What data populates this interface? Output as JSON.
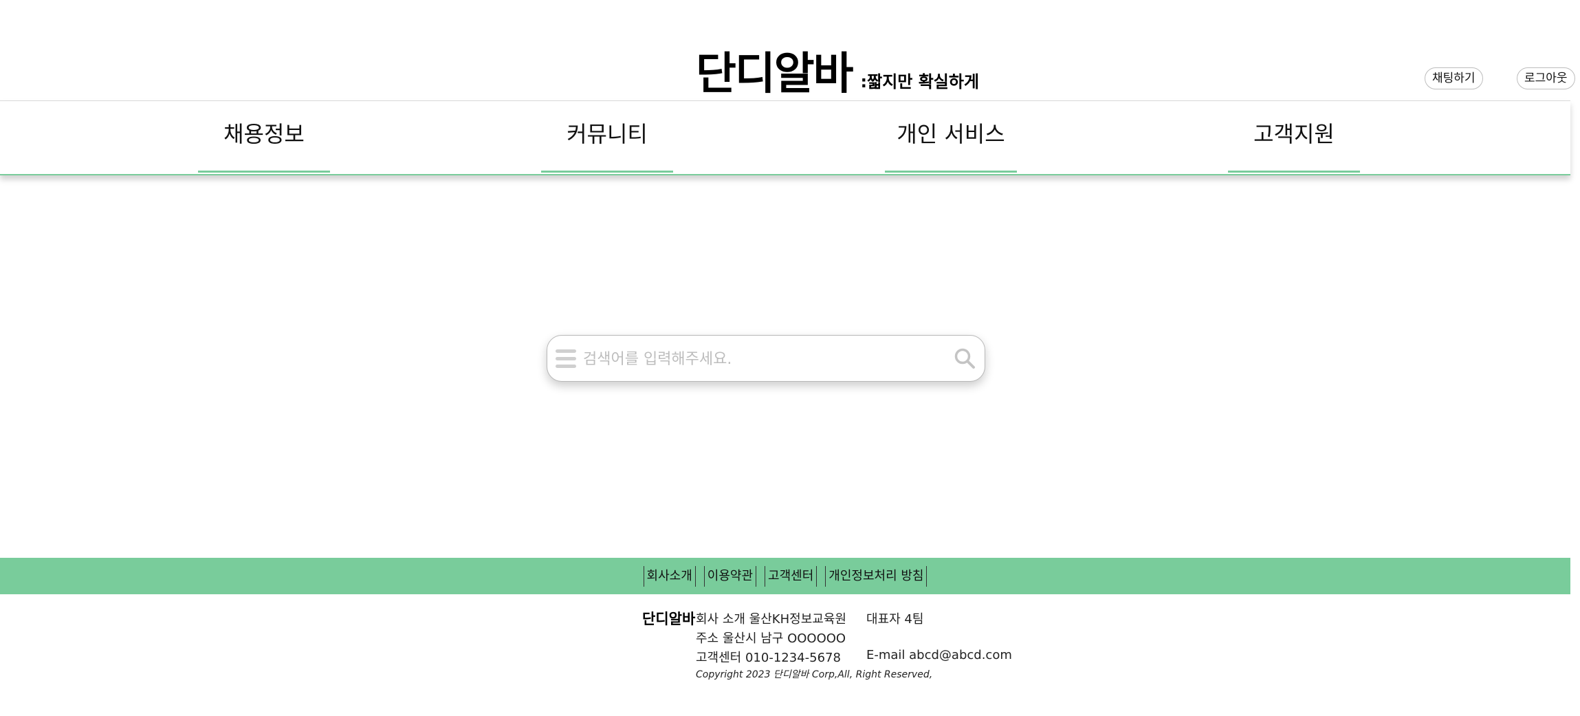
{
  "header": {
    "logo": "단디알바",
    "slogan": ":짧지만 확실하게",
    "chat_label": "채팅하기",
    "logout_label": "로그아웃"
  },
  "nav": {
    "items": [
      {
        "label": "채용정보"
      },
      {
        "label": "커뮤니티"
      },
      {
        "label": "개인 서비스"
      },
      {
        "label": "고객지원"
      }
    ]
  },
  "search": {
    "placeholder": "검색어를 입력해주세요.",
    "value": ""
  },
  "footer": {
    "links": [
      "회사소개",
      "이용약관",
      "고객센터",
      "개인정보처리 방침"
    ],
    "brand": "단디알바",
    "company": "회사 소개 울산KH정보교육원",
    "ceo": "대표자 4팀",
    "address": "주소 울산시 남구 OOOOOO",
    "phone": "고객센터 010-1234-5678",
    "email": "E-mail abcd@abcd.com",
    "copyright": "Copyright 2023 단디알바 Corp,All, Right Reserved,"
  },
  "colors": {
    "accent": "#79cc9b",
    "border": "#b8b8b8",
    "placeholder": "#bdbdbd"
  },
  "icons": {
    "menu": "hamburger-menu-icon",
    "search": "search-icon"
  }
}
